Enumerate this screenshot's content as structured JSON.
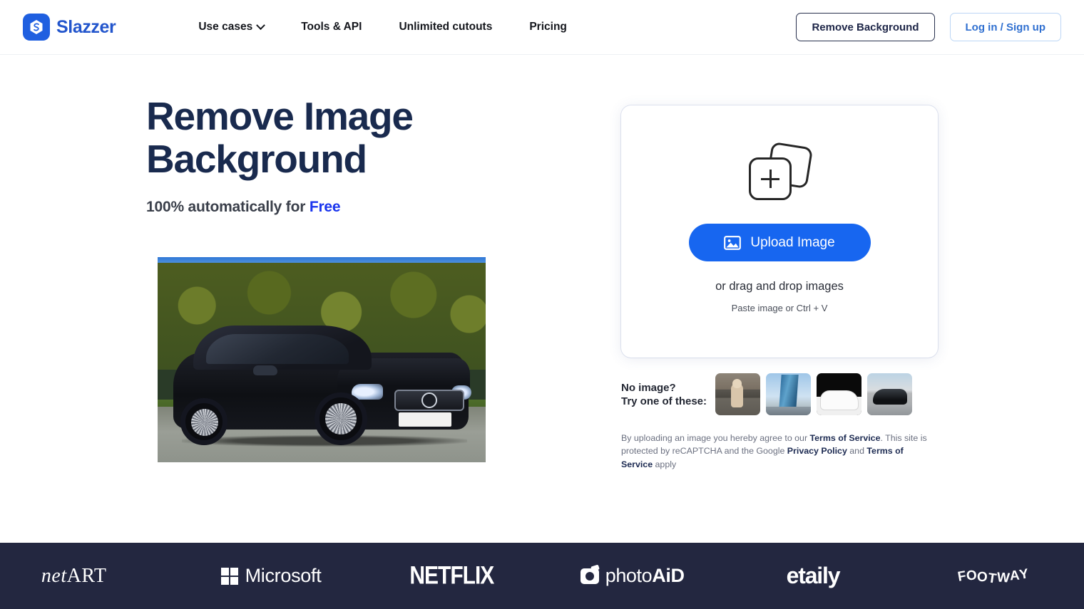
{
  "header": {
    "brand": {
      "name": "Slazzer",
      "mark_icon": "slazzer-logo-icon",
      "color": "#2255cc"
    },
    "nav": [
      {
        "label": "Use cases",
        "has_dropdown": true
      },
      {
        "label": "Tools & API",
        "has_dropdown": false
      },
      {
        "label": "Unlimited cutouts",
        "has_dropdown": false
      },
      {
        "label": "Pricing",
        "has_dropdown": false
      }
    ],
    "actions": {
      "remove_background": "Remove Background",
      "login_signup": "Log in / Sign up"
    }
  },
  "hero": {
    "title_line1": "Remove Image",
    "title_line2": "Background",
    "subtitle_prefix": "100% automatically for ",
    "subtitle_highlight": "Free",
    "highlight_color": "#1a35ee",
    "photo_alt": "black Mercedes coupe parked in front of a green hedge"
  },
  "upload": {
    "icon": "stacked-images-plus-icon",
    "button_label": "Upload Image",
    "button_icon": "image-icon",
    "button_color": "#1766f0",
    "drag_text": "or drag and drop images",
    "paste_text": "Paste image or Ctrl + V"
  },
  "samples": {
    "label_line1": "No image?",
    "label_line2": "Try one of these:",
    "thumbnails": [
      {
        "name": "sample-dog",
        "alt": "dog sitting on pavement"
      },
      {
        "name": "sample-skyscraper",
        "alt": "glass skyscraper"
      },
      {
        "name": "sample-white-suv",
        "alt": "white SUV on black background"
      },
      {
        "name": "sample-black-car",
        "alt": "black car in parking lot"
      }
    ]
  },
  "legal": {
    "part1": "By uploading an image you hereby agree to our ",
    "link1": "Terms of Service",
    "part2": ". This site is protected by reCAPTCHA and the Google ",
    "link2": "Privacy Policy",
    "part3": " and ",
    "link3": "Terms of Service",
    "part4": " apply"
  },
  "footer": {
    "background": "#232740",
    "logos": [
      {
        "name": "netart-logo",
        "text_italic": "net",
        "text_rest": "ART"
      },
      {
        "name": "microsoft-logo",
        "text": "Microsoft"
      },
      {
        "name": "netflix-logo",
        "text": "NETFLIX"
      },
      {
        "name": "photoaid-logo",
        "text_light": "photo",
        "text_bold": "AiD"
      },
      {
        "name": "etaily-logo",
        "text": "etaily"
      },
      {
        "name": "footway-logo",
        "text": "FOOTWAY"
      }
    ]
  }
}
